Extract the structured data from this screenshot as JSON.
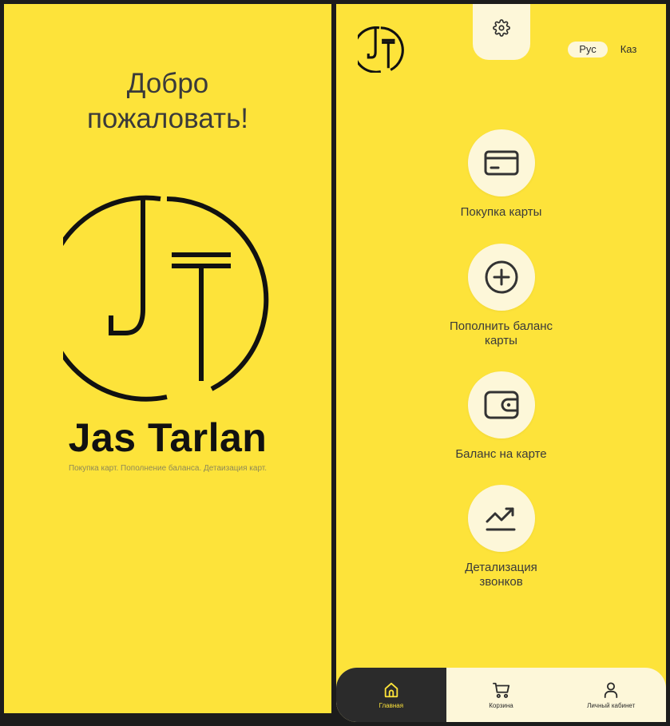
{
  "welcome": {
    "title": "Добро\nпожаловать!",
    "brand_name": "Jas Tarlan",
    "tagline": "Покупка карт. Пополнение баланса. Детаизация карт."
  },
  "header": {
    "settings_icon": "gear-icon",
    "languages": [
      {
        "label": "Рус",
        "selected": true
      },
      {
        "label": "Каз",
        "selected": false
      }
    ]
  },
  "menu": [
    {
      "label": "Покупка карты",
      "icon": "card-icon"
    },
    {
      "label": "Пополнить баланс\nкарты",
      "icon": "plus-circle-icon"
    },
    {
      "label": "Баланс на карте",
      "icon": "wallet-icon"
    },
    {
      "label": "Детализация\nзвонков",
      "icon": "trend-chart-icon"
    }
  ],
  "bottom_nav": [
    {
      "label": "Главная",
      "icon": "home-icon",
      "active": true
    },
    {
      "label": "Корзина",
      "icon": "cart-icon",
      "active": false
    },
    {
      "label": "Личный кабинет",
      "icon": "user-icon",
      "active": false
    }
  ],
  "colors": {
    "primary_yellow": "#fde33a",
    "cream": "#fdf7d9",
    "dark": "#2b2b2b",
    "text": "#3a3a3a"
  }
}
